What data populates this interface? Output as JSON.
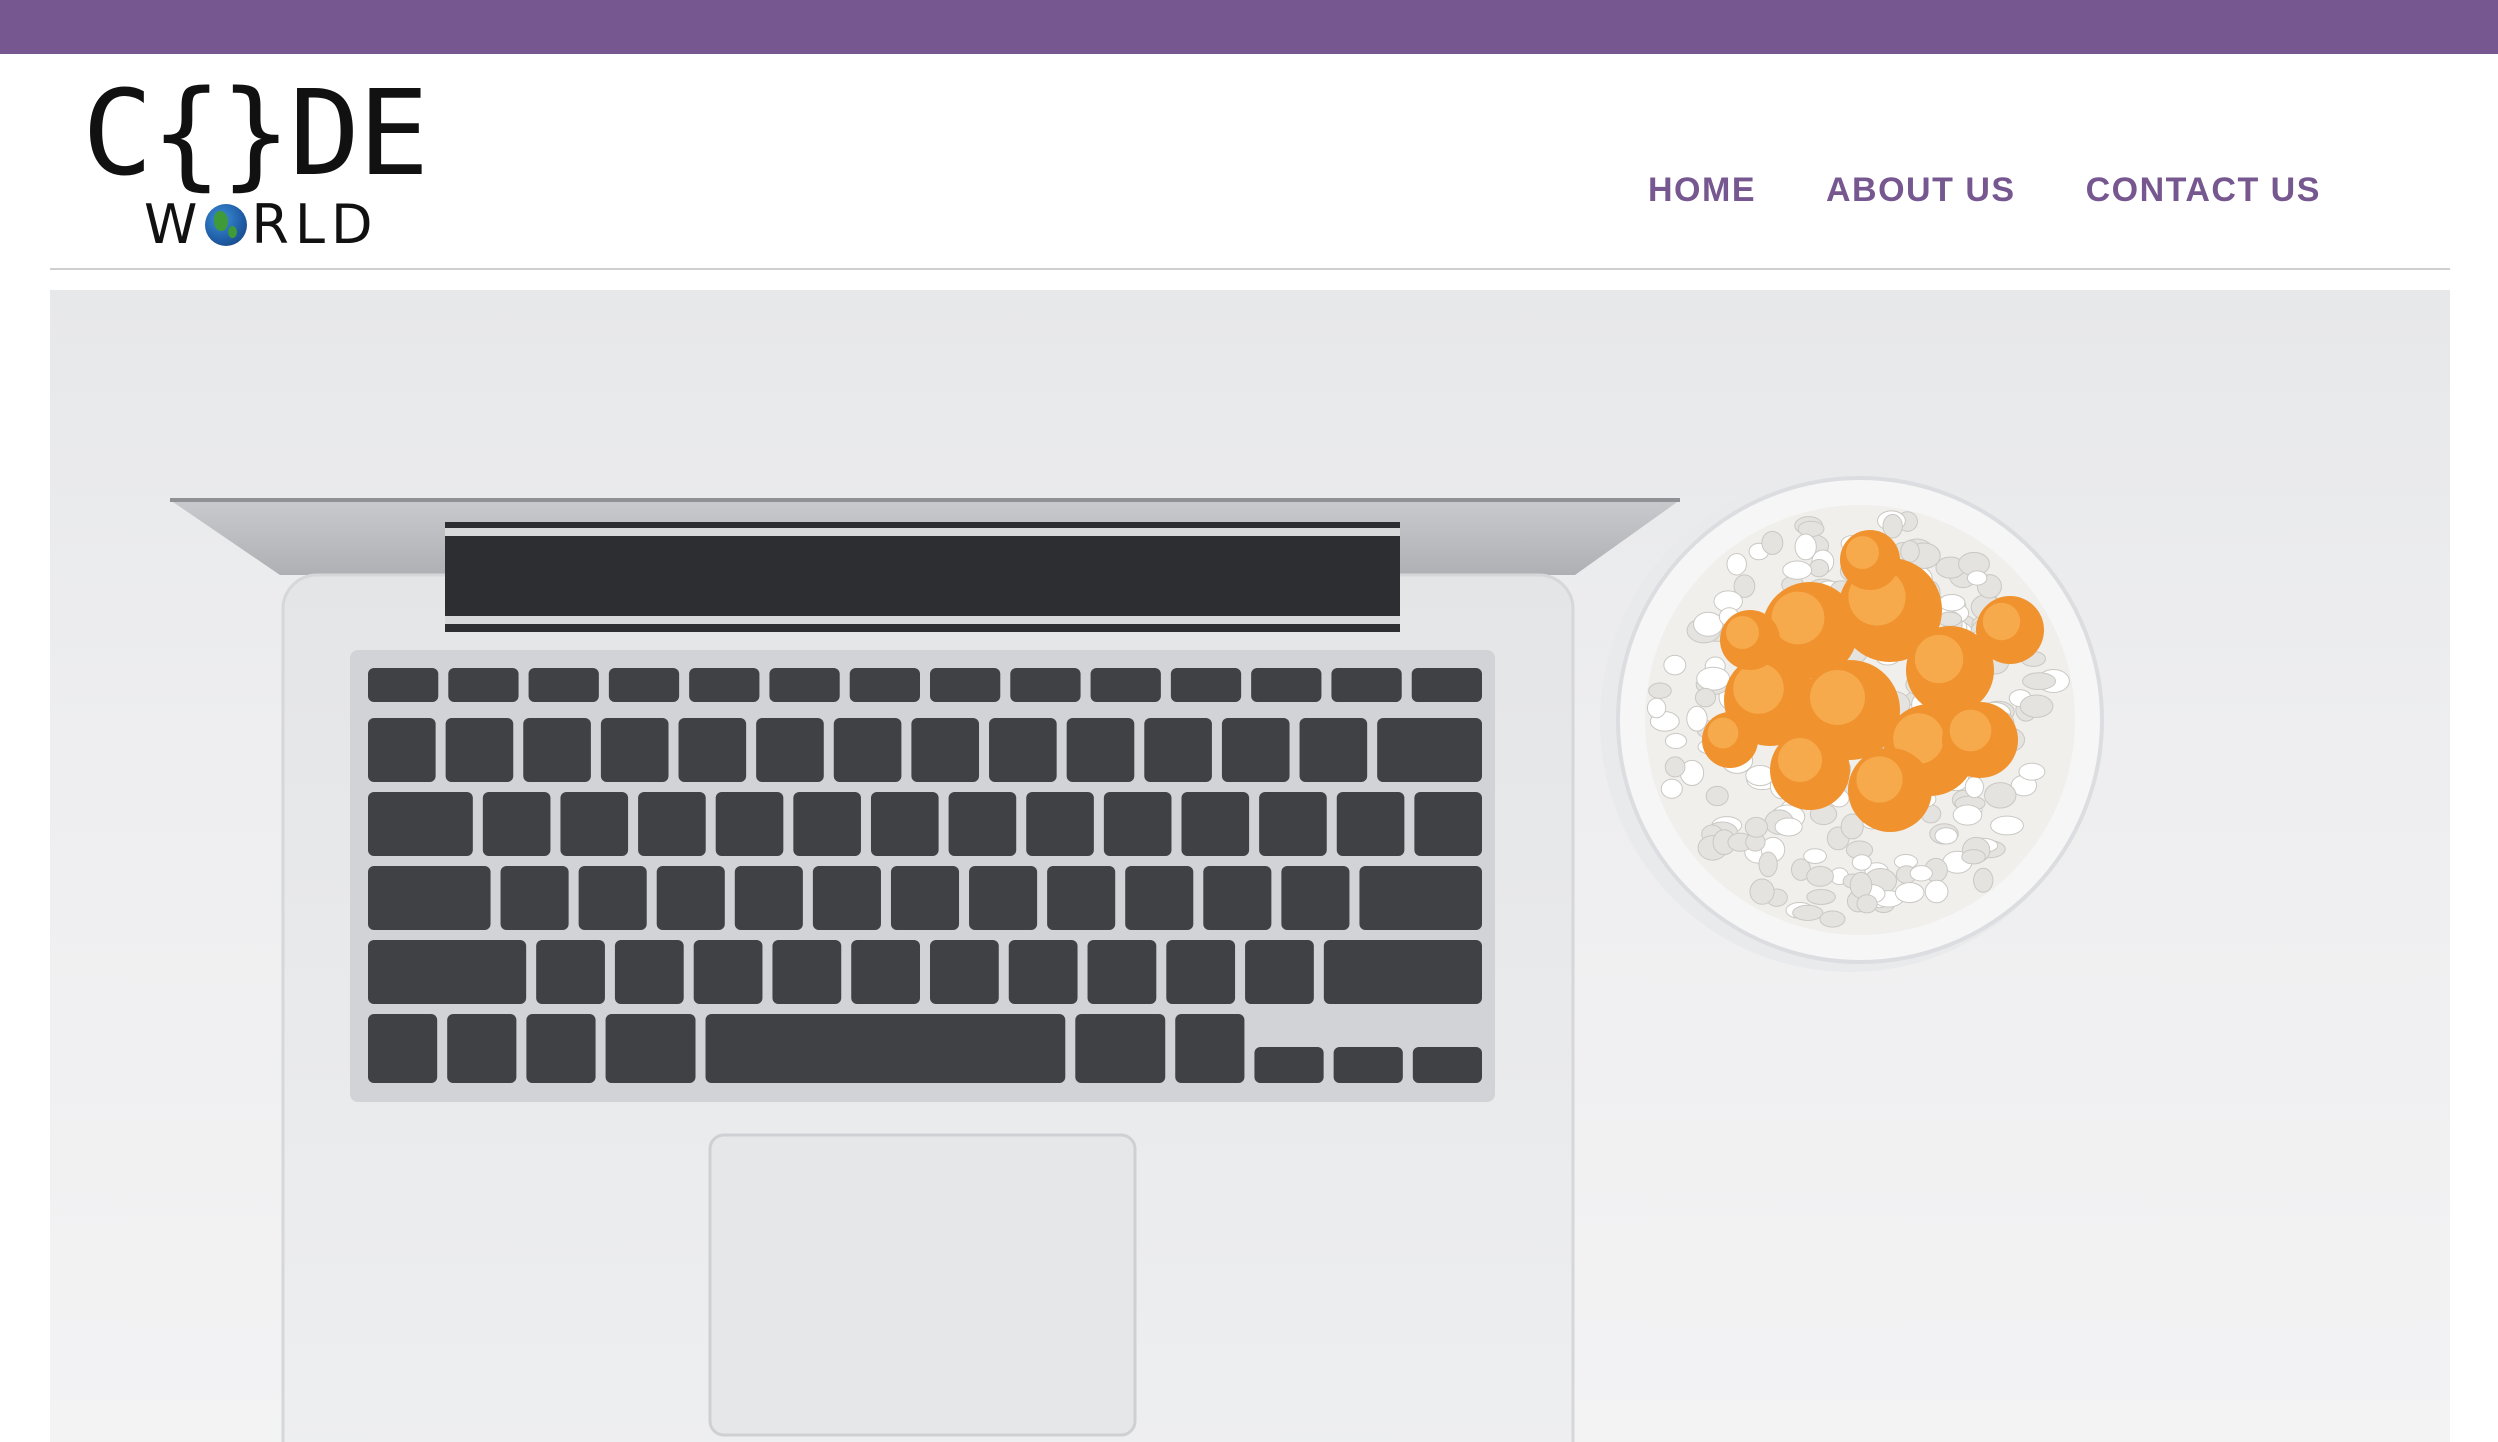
{
  "brand": {
    "accent_color": "#76578f",
    "logo_code": "C{}DE",
    "logo_world_w": "W",
    "logo_world_rest": "RLD",
    "logo_globe_icon": "globe-icon"
  },
  "nav": {
    "items": [
      {
        "label": "HOME"
      },
      {
        "label": "ABOUT US"
      },
      {
        "label": "CONTACT US"
      }
    ]
  },
  "hero": {
    "image": "laptop keyboard and orange cactus in white pebble pot on light grey desk"
  }
}
